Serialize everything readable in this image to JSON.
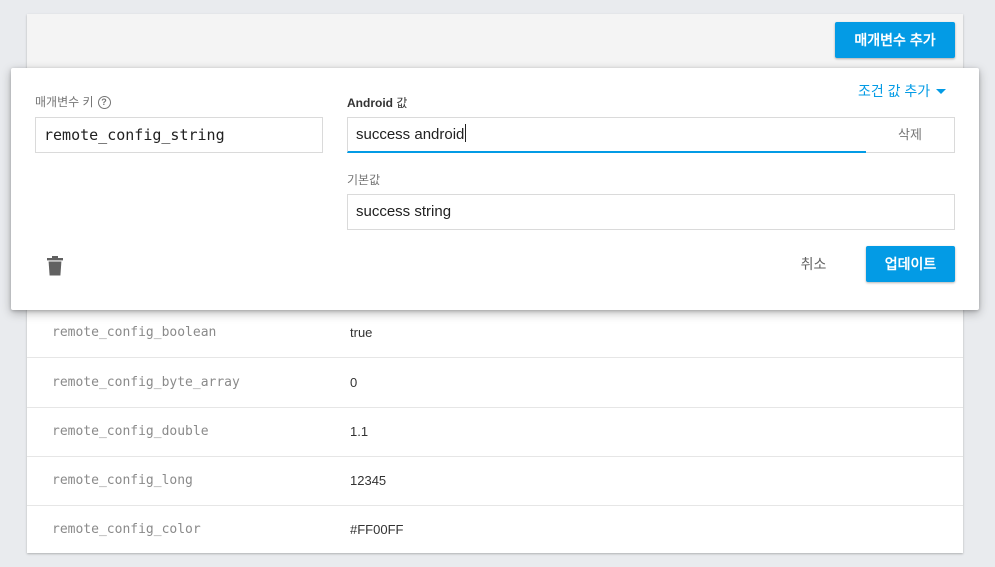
{
  "header": {
    "add_param_label": "매개변수 추가"
  },
  "editor": {
    "param_key_label": "매개변수 키",
    "help_icon": "?",
    "param_key_value": "remote_config_string",
    "android_label_bold": "Android",
    "android_label_suffix": " 값",
    "android_value": "success android",
    "delete_value_label": "삭제",
    "add_condition_label": "조건 값 추가",
    "default_label": "기본값",
    "default_value": "success string",
    "cancel_label": "취소",
    "update_label": "업데이트"
  },
  "params": [
    {
      "key": "remote_config_boolean",
      "value": "true"
    },
    {
      "key": "remote_config_byte_array",
      "value": "0"
    },
    {
      "key": "remote_config_double",
      "value": "1.1"
    },
    {
      "key": "remote_config_long",
      "value": "12345"
    },
    {
      "key": "remote_config_color",
      "value": "#FF00FF"
    }
  ],
  "icons": {
    "trash": "trash-icon",
    "dropdown": "caret-down-icon",
    "help": "help-circle-icon"
  },
  "colors": {
    "accent": "#039be5",
    "background": "#e9ebee"
  }
}
